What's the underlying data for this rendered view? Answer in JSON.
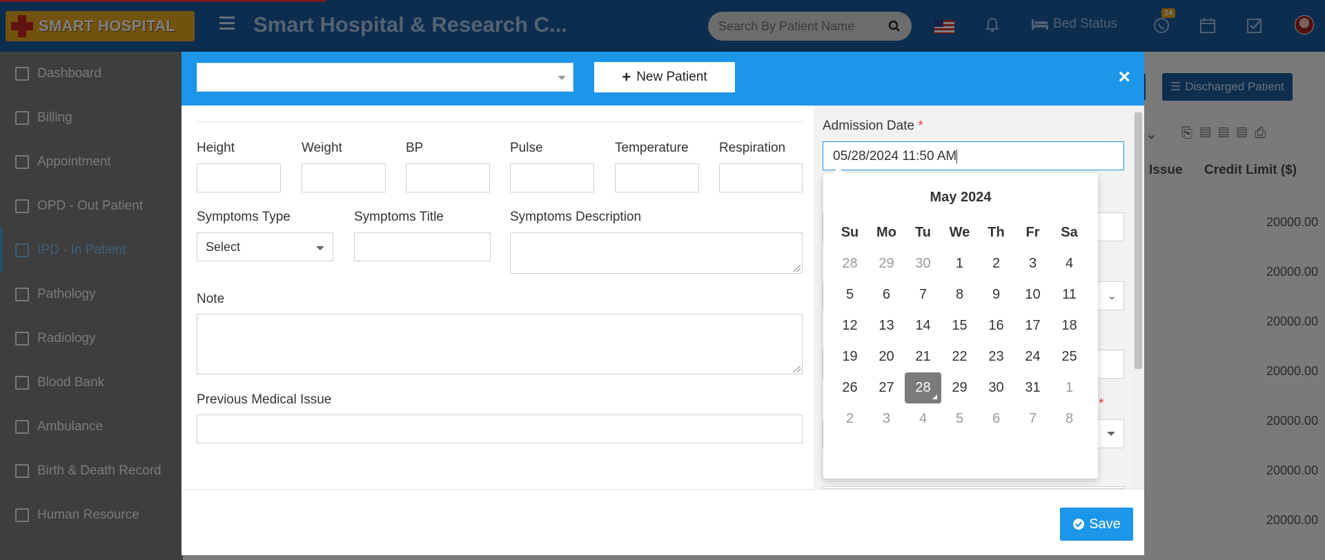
{
  "header": {
    "logo_text": "SMART HOSPITAL",
    "app_title": "Smart Hospital & Research C...",
    "search_placeholder": "Search By Patient Name",
    "bed_status": "Bed Status",
    "notification_badge": "24"
  },
  "sidebar": {
    "items": [
      {
        "label": "Dashboard",
        "icon": "monitor-icon"
      },
      {
        "label": "Billing",
        "icon": "receipt-icon"
      },
      {
        "label": "Appointment",
        "icon": "calendar-check-icon"
      },
      {
        "label": "OPD - Out Patient",
        "icon": "stethoscope-icon"
      },
      {
        "label": "IPD - In Patient",
        "icon": "bed-icon"
      },
      {
        "label": "Pathology",
        "icon": "flask-icon"
      },
      {
        "label": "Radiology",
        "icon": "microscope-icon"
      },
      {
        "label": "Blood Bank",
        "icon": "drop-icon"
      },
      {
        "label": "Ambulance",
        "icon": "ambulance-icon"
      },
      {
        "label": "Birth & Death Record",
        "icon": "birthday-cake-icon"
      },
      {
        "label": "Human Resource",
        "icon": "sitemap-icon"
      }
    ],
    "active_index": 4
  },
  "background": {
    "discharged_button": "Discharged Patient",
    "col_issue": "Issue",
    "col_credit": "Credit Limit ($)",
    "credit_values": [
      "20000.00",
      "20000.00",
      "20000.00",
      "20000.00",
      "20000.00",
      "20000.00",
      "20000.00"
    ]
  },
  "modal": {
    "patient_select_value": "",
    "new_patient_label": "New Patient",
    "close_label": "×",
    "vitals": {
      "height_label": "Height",
      "weight_label": "Weight",
      "bp_label": "BP",
      "pulse_label": "Pulse",
      "temperature_label": "Temperature",
      "respiration_label": "Respiration"
    },
    "symptoms_type_label": "Symptoms Type",
    "symptoms_type_value": "Select",
    "symptoms_title_label": "Symptoms Title",
    "symptoms_description_label": "Symptoms Description",
    "note_label": "Note",
    "previous_medical_issue_label": "Previous Medical Issue",
    "admission_date_label": "Admission Date",
    "required_marker": "*",
    "admission_date_value": "05/28/2024 11:50 AM",
    "save_label": "Save"
  },
  "calendar": {
    "month_label": "May 2024",
    "weekdays": [
      "Su",
      "Mo",
      "Tu",
      "We",
      "Th",
      "Fr",
      "Sa"
    ],
    "weeks": [
      [
        "28",
        "29",
        "30",
        "1",
        "2",
        "3",
        "4"
      ],
      [
        "5",
        "6",
        "7",
        "8",
        "9",
        "10",
        "11"
      ],
      [
        "12",
        "13",
        "14",
        "15",
        "16",
        "17",
        "18"
      ],
      [
        "19",
        "20",
        "21",
        "22",
        "23",
        "24",
        "25"
      ],
      [
        "26",
        "27",
        "28",
        "29",
        "30",
        "31",
        "1"
      ],
      [
        "2",
        "3",
        "4",
        "5",
        "6",
        "7",
        "8"
      ]
    ],
    "selected_day": "28"
  },
  "colors": {
    "header_bg": "#1a5a9e",
    "modal_header": "#1b96e8",
    "accent": "#1b96e8",
    "required": "#e23c3c"
  }
}
